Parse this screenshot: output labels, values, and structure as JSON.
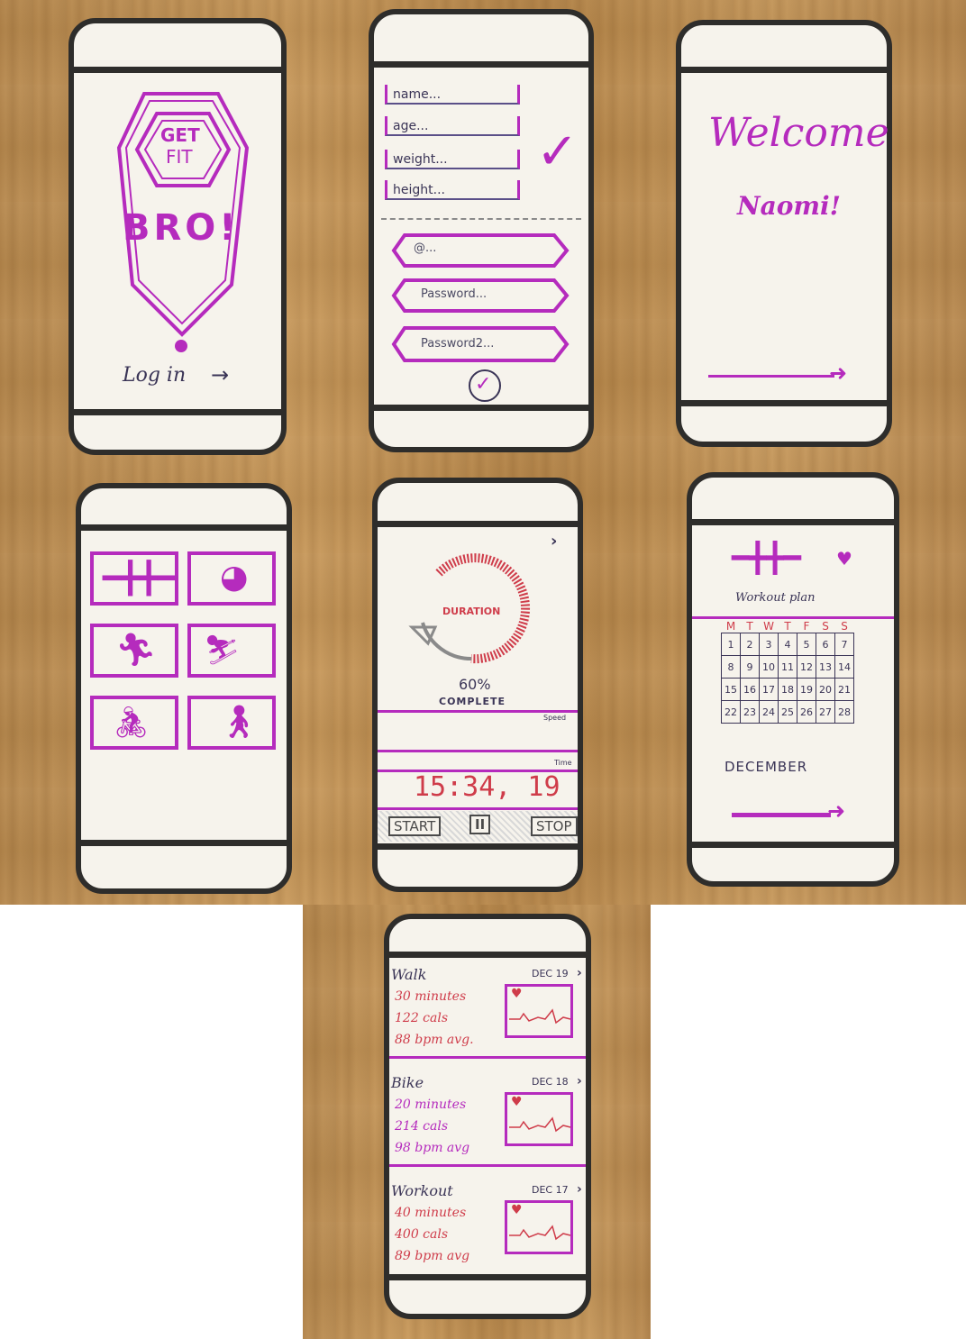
{
  "screens": {
    "splash": {
      "logo_top": "GET",
      "logo_mid": "FIT",
      "logo_bottom": "BRO!",
      "login_label": "Log in"
    },
    "signup": {
      "name_placeholder": "name...",
      "age_placeholder": "age...",
      "weight_placeholder": "weight...",
      "height_placeholder": "height...",
      "email_placeholder": "@...",
      "password_placeholder": "Password...",
      "password2_placeholder": "Password2..."
    },
    "welcome": {
      "title": "Welcome",
      "name": "Naomi!"
    },
    "categories": {
      "tiles": [
        "dumbbell-icon",
        "ball-icon",
        "running-icon",
        "stairs-icon",
        "cycling-icon",
        "walking-icon"
      ]
    },
    "tracker": {
      "gauge_label": "DURATION",
      "progress_percent": "60%",
      "progress_label": "COMPLETE",
      "progress_value": 0.6,
      "speed_label": "Speed",
      "time_label": "Time",
      "timer": "15:34, 19",
      "start_label": "START",
      "pause_label": "II",
      "stop_label": "STOP"
    },
    "plan": {
      "title": "Workout plan",
      "weekdays": [
        "M",
        "T",
        "W",
        "T",
        "F",
        "S",
        "S"
      ],
      "weeks": [
        [
          "1",
          "2",
          "3",
          "4",
          "5",
          "6",
          "7"
        ],
        [
          "8",
          "9",
          "10",
          "11",
          "12",
          "13",
          "14"
        ],
        [
          "15",
          "16",
          "17",
          "18",
          "19",
          "20",
          "21"
        ],
        [
          "22",
          "23",
          "24",
          "25",
          "26",
          "27",
          "28"
        ]
      ],
      "month": "DECEMBER"
    },
    "history": {
      "entries": [
        {
          "activity": "Walk",
          "date": "DEC 19",
          "duration": "30 minutes",
          "calories": "122 cals",
          "heart_rate": "88 bpm avg."
        },
        {
          "activity": "Bike",
          "date": "DEC 18",
          "duration": "20 minutes",
          "calories": "214 cals",
          "heart_rate": "98 bpm avg"
        },
        {
          "activity": "Workout",
          "date": "DEC 17",
          "duration": "40 minutes",
          "calories": "400 cals",
          "heart_rate": "89 bpm avg"
        }
      ]
    }
  },
  "colors": {
    "marker": "#b52bbd",
    "pencil": "#3a3456",
    "red": "#cf3c4a",
    "frame": "#2e2d2b",
    "paper": "#f6f3ec"
  }
}
